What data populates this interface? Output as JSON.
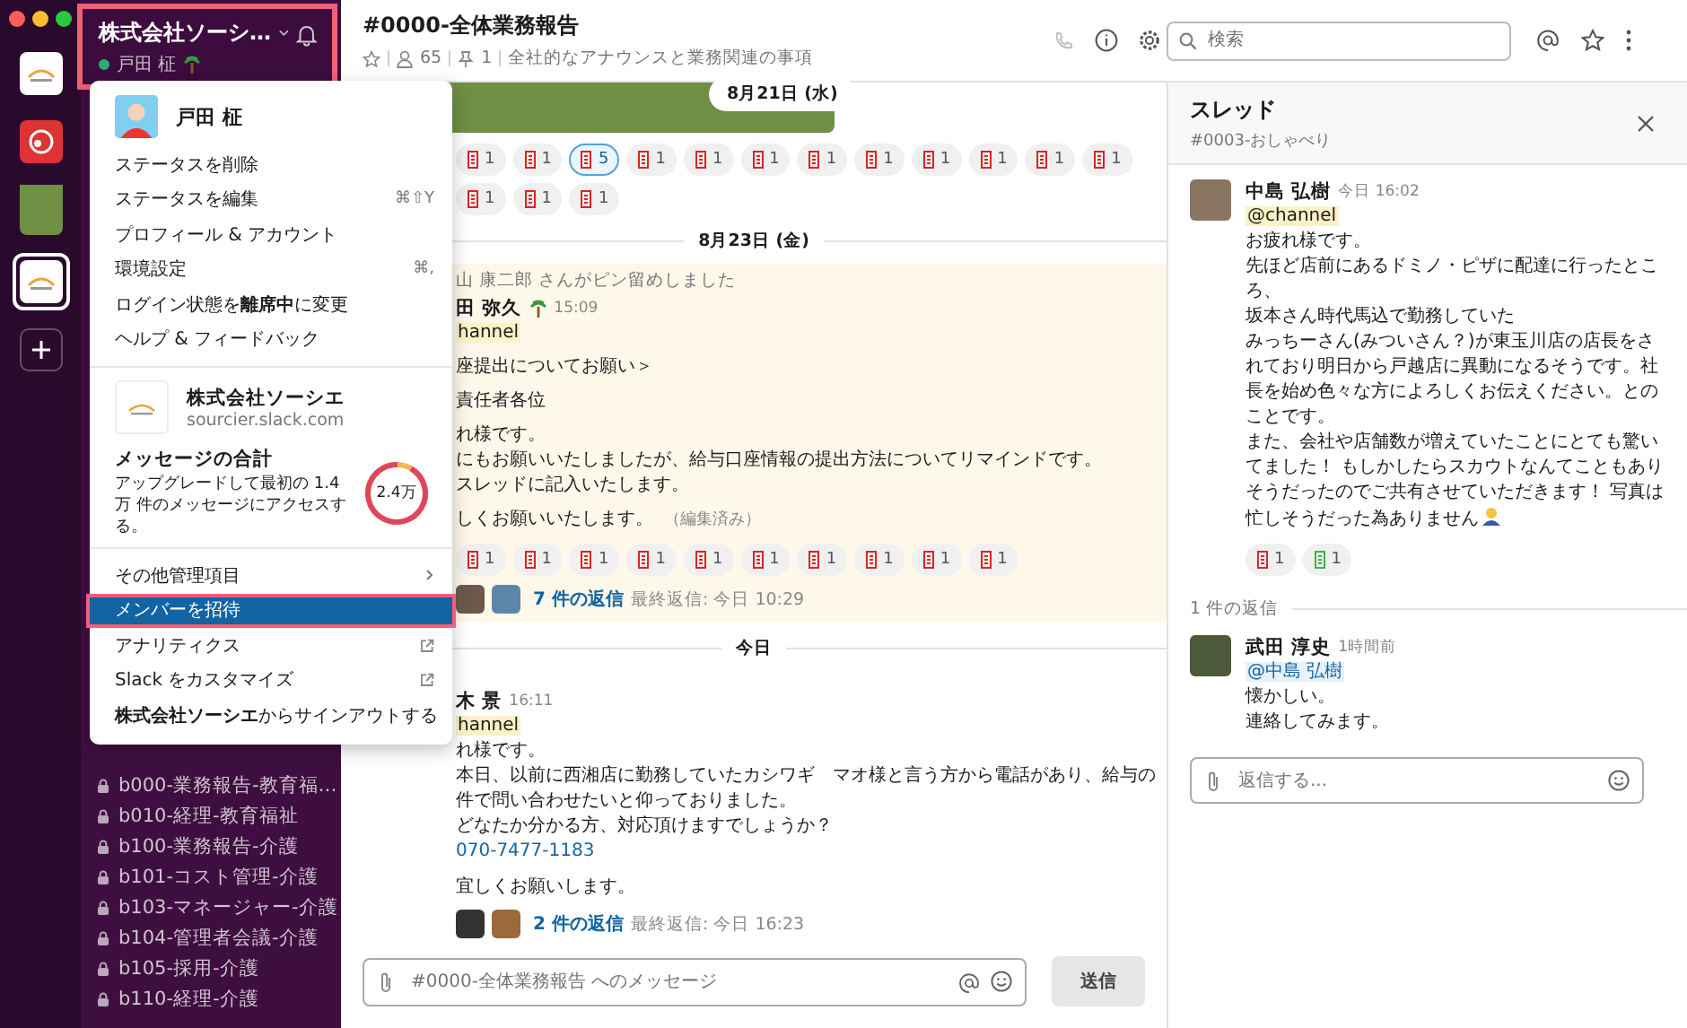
{
  "workspaces": [
    {
      "kind": "logo",
      "selected": false
    },
    {
      "kind": "logo-red",
      "selected": false
    },
    {
      "kind": "photo",
      "selected": false
    },
    {
      "kind": "logo",
      "selected": true
    }
  ],
  "sidebar": {
    "workspace_name": "株式会社ソーシ…",
    "user": "戸田 柾",
    "online": true,
    "highlighted": true,
    "channels": [
      {
        "name": "b000-業務報告-教育福…"
      },
      {
        "name": "b010-経理-教育福祉"
      },
      {
        "name": "b100-業務報告-介護"
      },
      {
        "name": "b101-コスト管理-介護"
      },
      {
        "name": "b103-マネージャー-介護"
      },
      {
        "name": "b104-管理者会議-介護"
      },
      {
        "name": "b105-採用-介護"
      },
      {
        "name": "b110-経理-介護"
      }
    ]
  },
  "menu": {
    "user": "戸田 柾",
    "status_items": [
      {
        "label": "ステータスを削除"
      },
      {
        "label": "ステータスを編集",
        "shortcut": "⌘⇧Y"
      },
      {
        "label": "プロフィール & アカウント"
      },
      {
        "label": "環境設定",
        "shortcut": "⌘,"
      },
      {
        "label": "ログイン状態を**離席中**に変更"
      },
      {
        "label": "ヘルプ & フィードバック"
      }
    ],
    "workspace": {
      "name": "株式会社ソーシエ",
      "domain": "sourcier.slack.com"
    },
    "usage": {
      "title": "メッセージの合計",
      "description": "アップグレードして最初の 1.4 万 件のメッセージにアクセスする。",
      "total": "2.4万",
      "level": 0.92
    },
    "admin_items": [
      {
        "label": "その他管理項目",
        "kind": "submenu",
        "selected": false
      },
      {
        "label": "メンバーを招待",
        "kind": "plain",
        "selected": true
      },
      {
        "label": "アナリティクス",
        "kind": "external",
        "selected": false
      },
      {
        "label": "Slack をカスタマイズ",
        "kind": "external",
        "selected": false
      },
      {
        "label": "**株式会社ソーシエ**からサインアウトする",
        "kind": "plain",
        "selected": false
      }
    ]
  },
  "channel_header": {
    "title": "#0000-全体業務報告",
    "members": "65",
    "pins": "1",
    "topic": "全社的なアナウンスと業務関連の事項"
  },
  "search": {
    "placeholder": "検索"
  },
  "feed": {
    "photo_date": "8月21日 (水)",
    "photo_reactions": [
      {
        "count": "1",
        "selected": false
      },
      {
        "count": "1",
        "selected": false
      },
      {
        "count": "5",
        "selected": true
      },
      {
        "count": "1",
        "selected": false
      },
      {
        "count": "1",
        "selected": false
      },
      {
        "count": "1",
        "selected": false
      },
      {
        "count": "1",
        "selected": false
      },
      {
        "count": "1",
        "selected": false
      },
      {
        "count": "1",
        "selected": false
      },
      {
        "count": "1",
        "selected": false
      },
      {
        "count": "1",
        "selected": false
      },
      {
        "count": "1",
        "selected": false
      },
      {
        "count": "1",
        "selected": false
      },
      {
        "count": "1",
        "selected": false
      },
      {
        "count": "1",
        "selected": false
      }
    ],
    "day_1": "8月23日 (金)",
    "pinned": {
      "pinned_by": "山 康二郎 さんがピン留めしました",
      "author": "田 弥久",
      "time": "15:09",
      "mention": "hannel",
      "paragraphs": [
        [
          "座提出についてお願い＞"
        ],
        [
          "責任者各位"
        ],
        [
          "れ様です。",
          "にもお願いいたしましたが、給与口座情報の提出方法についてリマインドです。",
          "スレッドに記入いたします。"
        ],
        [
          "しくお願いいたします。"
        ]
      ],
      "edited": "（編集済み）",
      "reactions": [
        {
          "count": "1"
        },
        {
          "count": "1"
        },
        {
          "count": "1"
        },
        {
          "count": "1"
        },
        {
          "count": "1"
        },
        {
          "count": "1"
        },
        {
          "count": "1"
        },
        {
          "count": "1"
        },
        {
          "count": "1"
        },
        {
          "count": "1"
        }
      ],
      "reply_count": "7 件の返信",
      "last_reply": "最終返信: 今日 10:29"
    },
    "day_2": "今日",
    "message": {
      "author": "木 景",
      "time": "16:11",
      "mention": "hannel",
      "paragraphs": [
        [
          "れ様です。",
          "本日、以前に西湘店に勤務していたカシワギ　マオ様と言う方から電話があり、給与の件で問い合わせたいと仰っておりました。",
          "どなたか分かる方、対応頂けますでしょうか？"
        ]
      ],
      "phone": "070-7477-1183",
      "closing": "宜しくお願いします。",
      "reply_count": "2 件の返信",
      "last_reply": "最終返信: 今日 16:23"
    },
    "composer": {
      "placeholder": "#0000-全体業務報告 へのメッセージ",
      "send": "送信"
    }
  },
  "thread": {
    "title": "スレッド",
    "channel": "#0003-おしゃべり",
    "parent": {
      "author": "中島 弘樹",
      "time": "今日 16:02",
      "mention": "@channel",
      "lines": [
        "お疲れ様です。",
        "先ほど店前にあるドミノ・ピザに配達に行ったところ、",
        "坂本さん時代馬込で勤務していた",
        "みっちーさん(みついさん？)が東玉川店の店長をされており明日から戸越店に異動になるそうです。社長を始め色々な方によろしくお伝えください。とのことです。",
        "また、会社や店舗数が増えていたことにとても驚いてました！ もしかしたらスカウトなんてこともありそうだったのでご共有させていただきます！ 写真は忙しそうだった為ありません"
      ],
      "reactions": [
        {
          "count": "1",
          "color": "#d7263d"
        },
        {
          "count": "1",
          "color": "#3cb44b"
        }
      ]
    },
    "replies_label": "1 件の返信",
    "reply": {
      "author": "武田 淳史",
      "time": "1時間前",
      "mention": "@中島 弘樹",
      "lines": [
        "懐かしい。",
        "連絡してみます。"
      ]
    },
    "composer": {
      "placeholder": "返信する..."
    }
  }
}
